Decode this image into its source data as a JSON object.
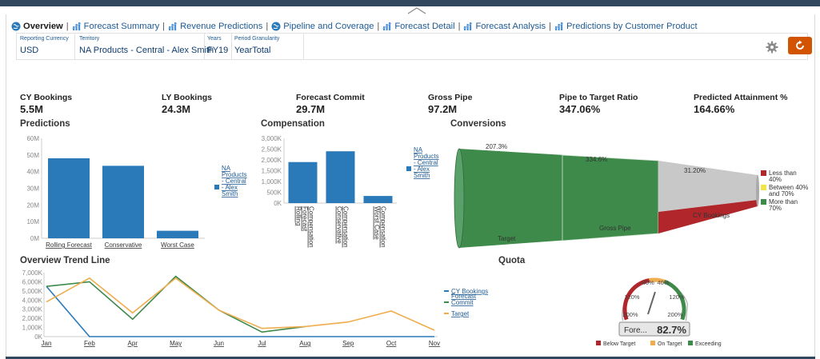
{
  "tabs": [
    {
      "label": "Overview",
      "icon": "globe-icon",
      "active": true
    },
    {
      "label": "Forecast Summary",
      "icon": "bars-icon"
    },
    {
      "label": "Revenue Predictions",
      "icon": "bars-icon"
    },
    {
      "label": "Pipeline and Coverage",
      "icon": "globe-icon"
    },
    {
      "label": "Forecast Detail",
      "icon": "bars-icon"
    },
    {
      "label": "Forecast Analysis",
      "icon": "bars-icon"
    },
    {
      "label": "Predictions by Customer Product",
      "icon": "bars-icon"
    }
  ],
  "tab_separator": "|",
  "prompts": [
    {
      "label": "Reporting Currency",
      "value": "USD"
    },
    {
      "label": "Territory",
      "value": "NA Products - Central - Alex Smith"
    },
    {
      "label": "Years",
      "value": "FY19"
    },
    {
      "label": "Period Granularity",
      "value": "YearTotal"
    }
  ],
  "colors": {
    "header": "#31475e",
    "accent": "#d35400",
    "bar": "#2a7ab9",
    "green": "#3e8a4a",
    "gray": "#c8c8c8",
    "red": "#b0262b",
    "yellow": "#f0e44a",
    "orange": "#f0ad4e"
  },
  "kpis": [
    {
      "label": "CY Bookings",
      "value": "5.5M"
    },
    {
      "label": "LY Bookings",
      "value": "24.3M"
    },
    {
      "label": "Forecast Commit",
      "value": "29.7M"
    },
    {
      "label": "Gross Pipe",
      "value": "97.2M"
    },
    {
      "label": "Pipe to Target Ratio",
      "value": "347.06%"
    },
    {
      "label": "Predicted Attainment %",
      "value": "164.66%"
    }
  ],
  "chart_data": [
    {
      "type": "bar",
      "title": "Predictions",
      "categories": [
        "Rolling Forecast",
        "Conservative",
        "Worst Case"
      ],
      "series": [
        {
          "name": "NA Products - Central - Alex Smith",
          "values": [
            48,
            43.5,
            4.5
          ]
        }
      ],
      "y_ticks": [
        "0M",
        "10M",
        "20M",
        "30M",
        "40M",
        "50M",
        "60M"
      ],
      "ylim": [
        0,
        60
      ],
      "legend_lines": [
        "NA",
        "Products",
        "- Central",
        "- Alex",
        "Smith"
      ]
    },
    {
      "type": "bar",
      "title": "Compensation",
      "categories": [
        "Rolling Forecast Compensation",
        "Conservative Compensation",
        "Worst Case Compensation"
      ],
      "category_lines": [
        [
          "Rolling",
          "Forecast",
          "Compensation"
        ],
        [
          "Conservative",
          "Compensation"
        ],
        [
          "Worst Case",
          "Compensation"
        ]
      ],
      "series": [
        {
          "name": "NA Products - Central - Alex Smith",
          "values": [
            1900,
            2400,
            330
          ]
        }
      ],
      "y_ticks": [
        "0K",
        "500K",
        "1,000K",
        "1,500K",
        "2,000K",
        "2,500K",
        "3,000K"
      ],
      "ylim": [
        0,
        3000
      ],
      "legend_lines": [
        "NA",
        "Products",
        "- Central",
        "- Alex",
        "Smith"
      ]
    },
    {
      "type": "funnel",
      "title": "Conversions",
      "stages": [
        {
          "name": "Target",
          "value_label": "207.3%"
        },
        {
          "name": "Gross Pipe",
          "value_label": "334.6%"
        },
        {
          "name": "CY Bookings",
          "value_label": "31.20%"
        }
      ],
      "legend": [
        {
          "label_lines": [
            "Less than",
            "40%"
          ],
          "color": "#b0262b"
        },
        {
          "label_lines": [
            "Between 40%",
            "and 70%"
          ],
          "color": "#f0e44a"
        },
        {
          "label_lines": [
            "More than",
            "70%"
          ],
          "color": "#3e8a4a"
        }
      ]
    },
    {
      "type": "line",
      "title": "Overview Trend Line",
      "x": [
        "Jan",
        "Feb",
        "Apr",
        "May",
        "Jun",
        "Jul",
        "Aug",
        "Sep",
        "Oct",
        "Nov"
      ],
      "y_ticks": [
        "0K",
        "1,000K",
        "2,000K",
        "3,000K",
        "4,000K",
        "5,000K",
        "6,000K",
        "7,000K"
      ],
      "ylim": [
        0,
        7000
      ],
      "series": [
        {
          "name": "CY Bookings",
          "color": "#2a7ab9",
          "values": [
            5500,
            0,
            0,
            0,
            0,
            0,
            0,
            0,
            0,
            0
          ]
        },
        {
          "name": "Forecast Commit",
          "legend_lines": [
            "Forecast",
            "Commit"
          ],
          "color": "#3e8a4a",
          "values": [
            5500,
            6000,
            1900,
            6600,
            2900,
            500,
            1100,
            null,
            null,
            null
          ]
        },
        {
          "name": "Target",
          "color": "#f0ad4e",
          "values": [
            3800,
            6400,
            2600,
            6400,
            2900,
            900,
            1100,
            1600,
            2800,
            700
          ]
        }
      ]
    },
    {
      "type": "gauge",
      "title": "Quota",
      "scale_labels": [
        "200%",
        "120%",
        "-40%",
        "40%",
        "120%",
        "200%"
      ],
      "value_label": "82.7%",
      "caption": "Fore...",
      "value": 82.7,
      "legend": [
        {
          "label": "Below Target",
          "color": "#b0262b"
        },
        {
          "label": "On Target",
          "color": "#f0ad4e"
        },
        {
          "label": "Exceeding",
          "color": "#3e8a4a"
        }
      ]
    }
  ]
}
